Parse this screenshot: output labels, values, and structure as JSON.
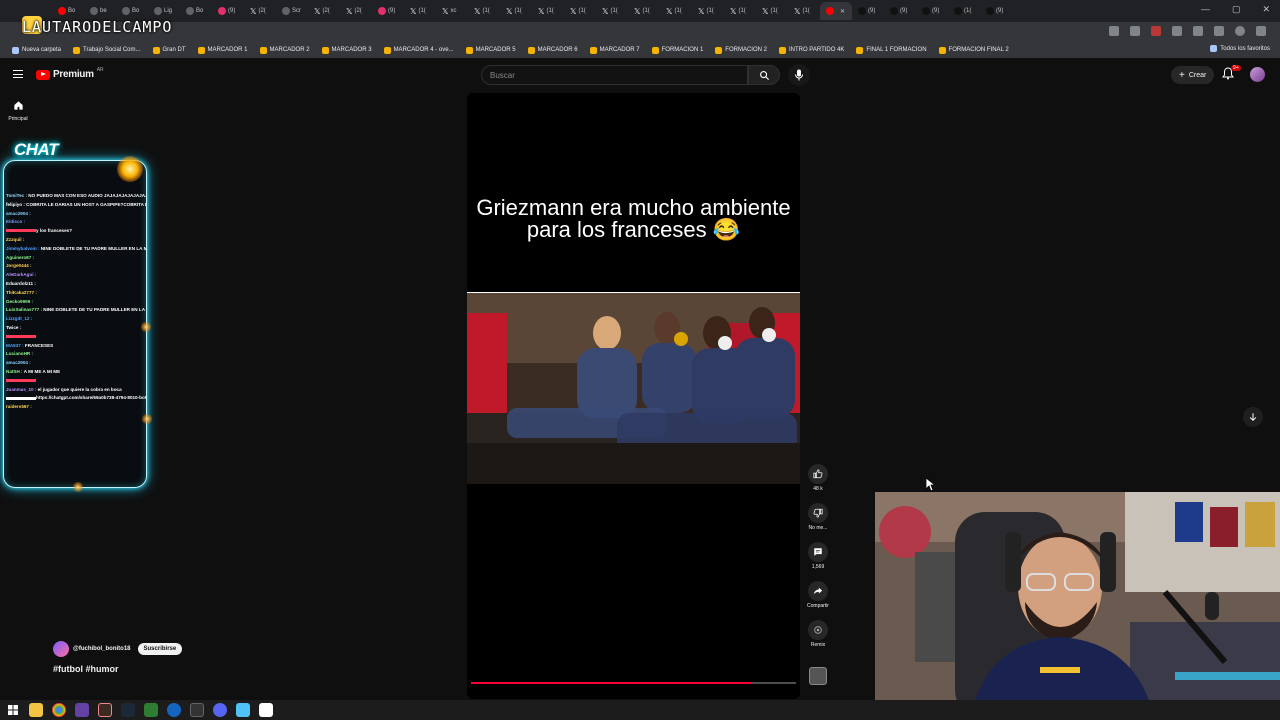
{
  "stream": {
    "title": "LAUTARODELCAMPO"
  },
  "browser": {
    "tabs": [
      {
        "label": "Bo",
        "icon": "youtube-favicon"
      },
      {
        "label": "be",
        "icon": "globe-favicon"
      },
      {
        "label": "Bo",
        "icon": "globe-favicon"
      },
      {
        "label": "Lig",
        "icon": "globe-favicon"
      },
      {
        "label": "Bo",
        "icon": "globe-favicon"
      },
      {
        "label": "(9)",
        "icon": "instagram-favicon"
      },
      {
        "label": "(2(",
        "icon": "x-favicon"
      },
      {
        "label": "Scr",
        "icon": "screen-favicon"
      },
      {
        "label": "(2(",
        "icon": "x-favicon"
      },
      {
        "label": "(2(",
        "icon": "x-favicon"
      },
      {
        "label": "(9)",
        "icon": "instagram-favicon"
      },
      {
        "label": "(1(",
        "icon": "x-favicon"
      },
      {
        "label": "xc",
        "icon": "x-favicon"
      },
      {
        "label": "(1(",
        "icon": "x-favicon"
      },
      {
        "label": "(1(",
        "icon": "x-favicon"
      },
      {
        "label": "(1(",
        "icon": "x-favicon"
      },
      {
        "label": "(1(",
        "icon": "x-favicon"
      },
      {
        "label": "(1(",
        "icon": "x-favicon"
      },
      {
        "label": "(1(",
        "icon": "x-favicon"
      },
      {
        "label": "(1(",
        "icon": "x-favicon"
      },
      {
        "label": "(1(",
        "icon": "x-favicon"
      },
      {
        "label": "(1(",
        "icon": "x-favicon"
      },
      {
        "label": "(1(",
        "icon": "x-favicon"
      },
      {
        "label": "(1(",
        "icon": "x-favicon"
      },
      {
        "label": "",
        "icon": "shorts-favicon",
        "active": true
      },
      {
        "label": "(9)",
        "icon": "tiktok-favicon"
      },
      {
        "label": "(9)",
        "icon": "tiktok-favicon"
      },
      {
        "label": "(9)",
        "icon": "tiktok-favicon"
      },
      {
        "label": "(1(",
        "icon": "tiktok-favicon"
      },
      {
        "label": "(9)",
        "icon": "tiktok-favicon"
      }
    ],
    "bookmarks": [
      {
        "label": "Nueva carpeta",
        "icon": "folder-icon"
      },
      {
        "label": "Trabajo Social Com...",
        "icon": "bookmark-icon"
      },
      {
        "label": "Gran DT",
        "icon": "bookmark-icon"
      },
      {
        "label": "MARCADOR 1",
        "icon": "bookmark-icon"
      },
      {
        "label": "MARCADOR 2",
        "icon": "bookmark-icon"
      },
      {
        "label": "MARCADOR 3",
        "icon": "bookmark-icon"
      },
      {
        "label": "MARCADOR 4 - ove...",
        "icon": "bookmark-icon"
      },
      {
        "label": "MARCADOR 5",
        "icon": "bookmark-icon"
      },
      {
        "label": "MARCADOR 6",
        "icon": "bookmark-icon"
      },
      {
        "label": "MARCADOR 7",
        "icon": "bookmark-icon"
      },
      {
        "label": "FORMACION 1",
        "icon": "bookmark-icon"
      },
      {
        "label": "FORMACION 2",
        "icon": "bookmark-icon"
      },
      {
        "label": "INTRO PARTIDO 4K",
        "icon": "bookmark-icon"
      },
      {
        "label": "FINAL 1 FORMACION",
        "icon": "bookmark-icon"
      },
      {
        "label": "FORMACION FINAL 2",
        "icon": "bookmark-icon"
      }
    ],
    "all_bookmarks": "Todos los favoritos"
  },
  "youtube": {
    "logo": "Premium",
    "country": "AR",
    "search_placeholder": "Buscar",
    "create_label": "Crear",
    "notif_badge": "9+",
    "nav_home": "Principal"
  },
  "chat": {
    "title": "CHAT",
    "messages": [
      {
        "user": "TomiTec",
        "text": "NO PUEDO MAS CON ESO AUDIO JAJAJAJAJAJAJAJAJAJAJAJ",
        "color": "#9ad7ff"
      },
      {
        "user": "felipiyo",
        "text": "COBRITA LE DARIAS UN HOST A GASPIPE?COBRITA LE DARIAS UN HOST A GASPIPE?",
        "color": "#ffffff"
      },
      {
        "user": "amac2904",
        "text": "",
        "color": "#7fd1ff"
      },
      {
        "user": "Eldisco",
        "text": "",
        "color": "#7a9cff"
      },
      {
        "user": "",
        "text": "y los franceses?",
        "color": "#ff3b5c"
      },
      {
        "user": "Zzzquil",
        "text": "",
        "color": "#ffd34f"
      },
      {
        "user": "Jimmybalvoin",
        "text": "NINE DOBLETE DE TU PADRE MULLER EN LA MLS",
        "color": "#4fa3ff"
      },
      {
        "user": "Aguinero87",
        "text": "",
        "color": "#8ef58e"
      },
      {
        "user": "Jorge0444",
        "text": "",
        "color": "#ffd34f"
      },
      {
        "user": "AleDarkAgui",
        "text": "",
        "color": "#b98cff"
      },
      {
        "user": "Eduardolz11",
        "text": "",
        "color": "#ffffff"
      },
      {
        "user": "ThiKaka2777",
        "text": "",
        "color": "#ffd34f"
      },
      {
        "user": "Gecko9999",
        "text": "",
        "color": "#8ef58e"
      },
      {
        "user": "LuisSalinas777",
        "text": "NINE DOBLETE DE TU PADRE MULLER EN LA MLS",
        "color": "#8ef58e"
      },
      {
        "user": "Lizzgdt_12",
        "text": "",
        "color": "#4fa3ff"
      },
      {
        "user": "Twice",
        "text": "",
        "color": "#ffffff"
      },
      {
        "user": "",
        "text": "",
        "color": "#ff3b5c"
      },
      {
        "user": "MA837",
        "text": "FRANCESES",
        "color": "#4fa3ff"
      },
      {
        "user": "LucianoHR",
        "text": "",
        "color": "#8ef58e"
      },
      {
        "user": "amac2904",
        "text": "",
        "color": "#7fd1ff"
      },
      {
        "user": "NatSH",
        "text": "A MI ME A MI ME",
        "color": "#8ef58e"
      },
      {
        "user": "",
        "text": "",
        "color": "#ff3b5c"
      },
      {
        "user": "Juanmas_10",
        "text": "el jugador que quiere la cobra en boca",
        "color": "#b98cff"
      },
      {
        "user": "",
        "text": "https://chatgpt.com/share/69a0b738-4794-8010-bc64-582a93c8b9c3",
        "color": "#ffffff"
      },
      {
        "user": "raiders567",
        "text": "",
        "color": "#ffd34f"
      }
    ]
  },
  "short": {
    "caption": "Griezmann era mucho ambiente para los franceses 😂",
    "progress": 0.86,
    "like_count": "48 k",
    "dislike_label": "No me...",
    "comments_count": "1,569",
    "share_label": "Compartir",
    "remix_label": "Remix",
    "channel": "@fuchibol_bonito18",
    "subscribe_label": "Suscribirse",
    "hashtags": "#futbol #humor"
  },
  "colors": {
    "accent": "#ff0000",
    "chat_glow": "#39e6ff",
    "progress": "#ff0033"
  }
}
